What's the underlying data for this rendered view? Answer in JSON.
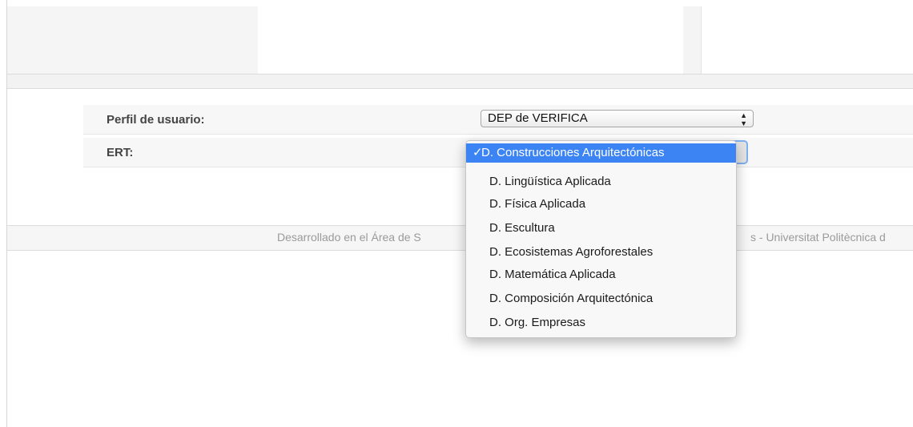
{
  "form": {
    "profile_label": "Perfil de usuario:",
    "profile_value": "DEP de VERIFICA",
    "ert_label": "ERT:"
  },
  "dropdown": {
    "check_glyph": "✓",
    "selected_index": 0,
    "options": [
      "D. Construcciones Arquitectónicas",
      "D. Lingüística Aplicada",
      "D. Física Aplicada",
      "D. Escultura",
      "D. Ecosistemas Agroforestales",
      "D. Matemática Aplicada",
      "D. Composición Arquitectónica",
      "D. Org. Empresas"
    ]
  },
  "footer": {
    "text_left": "Desarrollado en el Área de S",
    "text_right": "s - Universitat Politècnica d"
  },
  "colors": {
    "highlight": "#3c84f4",
    "label_text": "#444444",
    "footer_text": "#9a9a9a"
  }
}
